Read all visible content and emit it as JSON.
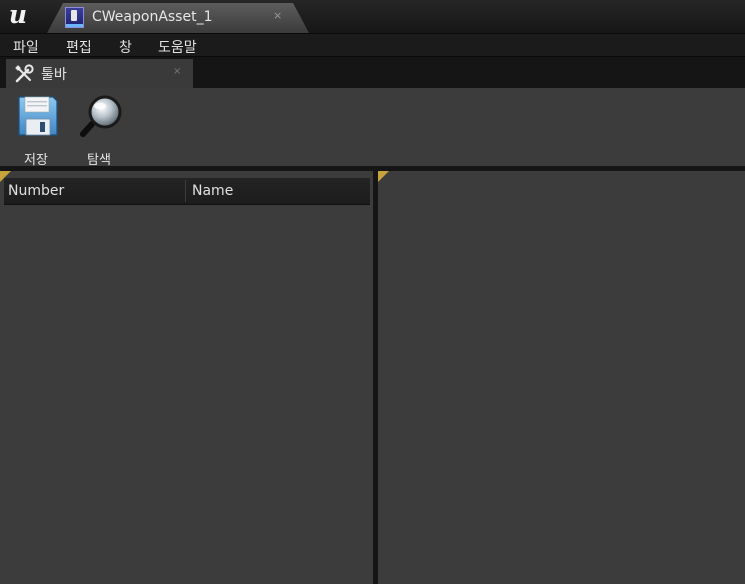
{
  "window": {
    "logo_icon": "unreal-engine-logo-icon",
    "document_tab": {
      "title": "CWeaponAsset_1",
      "icon": "data-asset-icon",
      "close_glyph": "×"
    }
  },
  "menu": {
    "items": [
      {
        "label": "파일"
      },
      {
        "label": "편집"
      },
      {
        "label": "창"
      },
      {
        "label": "도움말"
      }
    ]
  },
  "toolbar_tab": {
    "label": "툴바",
    "icon": "wrench-screwdriver-icon",
    "close_glyph": "×"
  },
  "toolbar": {
    "buttons": [
      {
        "label": "저장",
        "icon": "floppy-disk-icon"
      },
      {
        "label": "탐색",
        "icon": "magnifier-icon"
      }
    ]
  },
  "list_view": {
    "columns": [
      {
        "label": "Number"
      },
      {
        "label": "Name"
      }
    ],
    "rows": []
  },
  "colors": {
    "panel_bg": "#3c3c3c",
    "frame_bg": "#151515",
    "accent_corner": "#c8a33c"
  }
}
